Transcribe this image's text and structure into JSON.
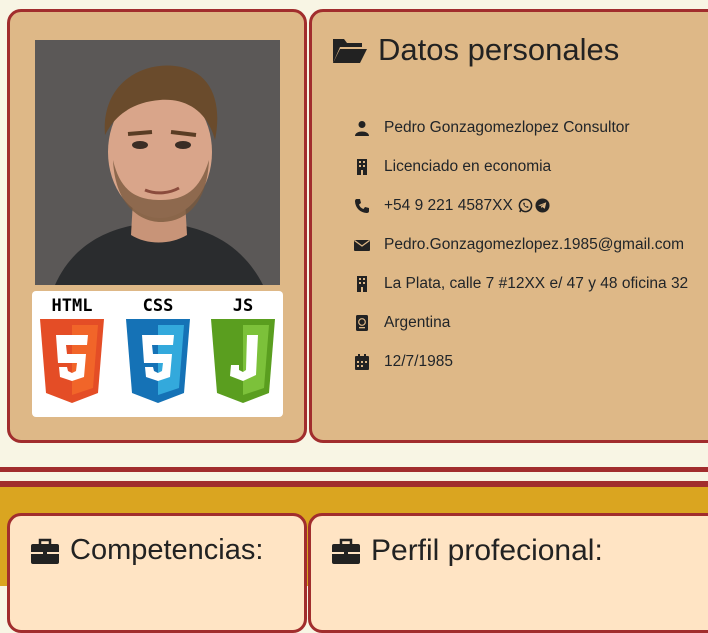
{
  "profile": {
    "photo_alt": "foto de perfil",
    "logos": [
      "HTML",
      "CSS",
      "JS"
    ]
  },
  "datos": {
    "title": "Datos personales",
    "items": [
      {
        "icon": "user-icon",
        "text": "Pedro Gonzagomezlopez Consultor"
      },
      {
        "icon": "building-icon",
        "text": "Licenciado en economia"
      },
      {
        "icon": "phone-icon",
        "text": "+54 9 221 4587XX"
      },
      {
        "icon": "envelope-icon",
        "text": "Pedro.Gonzagomezlopez.1985@gmail.com"
      },
      {
        "icon": "building-icon",
        "text": "La Plata, calle 7 #12XX e/ 47 y 48 oficina 32"
      },
      {
        "icon": "passport-icon",
        "text": "Argentina"
      },
      {
        "icon": "calendar-icon",
        "text": "12/7/1985"
      }
    ]
  },
  "competencias": {
    "title": "Competencias:"
  },
  "perfil": {
    "title": "Perfil profecional:"
  },
  "colors": {
    "border": "#a12d2d",
    "card_bg": "#deb887",
    "bottom_bg": "#daa520",
    "card2_bg": "#ffe4c4",
    "html_orange": "#e44d26",
    "css_blue": "#1572b6",
    "js_green": "#6aab2e"
  }
}
